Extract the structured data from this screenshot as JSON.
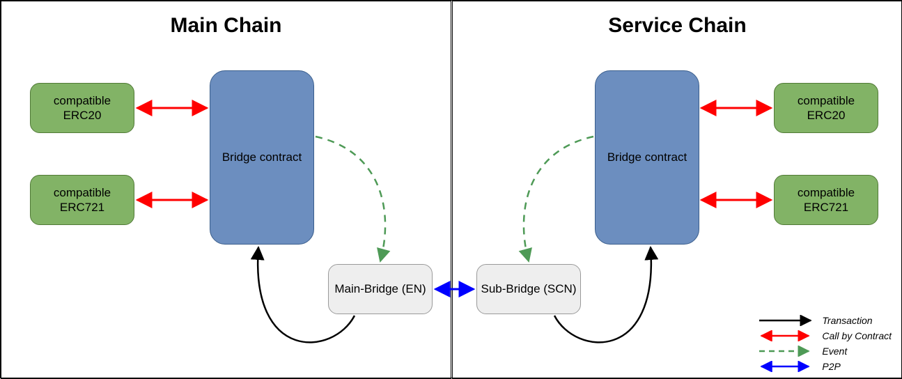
{
  "titles": {
    "main": "Main Chain",
    "service": "Service Chain"
  },
  "nodes": {
    "erc20_left": "compatible ERC20",
    "erc721_left": "compatible ERC721",
    "bridge_left": "Bridge contract",
    "main_bridge": "Main-Bridge (EN)",
    "sub_bridge": "Sub-Bridge (SCN)",
    "bridge_right": "Bridge contract",
    "erc20_right": "compatible ERC20",
    "erc721_right": "compatible ERC721"
  },
  "legend": {
    "transaction": "Transaction",
    "call_by_contract": "Call by Contract",
    "event": "Event",
    "p2p": "P2P"
  },
  "colors": {
    "green_fill": "#82b366",
    "green_stroke": "#507a36",
    "blue_fill": "#6c8ebf",
    "blue_stroke": "#3a5e8c",
    "grey_fill": "#eeeeee",
    "grey_stroke": "#999999",
    "arrow_red": "#ff0000",
    "arrow_green": "#4e9a56",
    "arrow_blue": "#0000ff",
    "arrow_black": "#000000"
  },
  "diagram_semantics": {
    "description": "Two-chain bridge architecture. Bridge contracts on each chain call ERC20/ERC721 compatible token contracts. Bridge contracts emit events to their local bridge nodes (Main-Bridge EN / Sub-Bridge SCN), which send transactions back to the opposite bridge contract. Main-Bridge and Sub-Bridge communicate over P2P.",
    "edges": [
      {
        "from": "bridge_left",
        "to": "erc20_left",
        "type": "call_by_contract",
        "bidirectional": true
      },
      {
        "from": "bridge_left",
        "to": "erc721_left",
        "type": "call_by_contract",
        "bidirectional": true
      },
      {
        "from": "bridge_right",
        "to": "erc20_right",
        "type": "call_by_contract",
        "bidirectional": true
      },
      {
        "from": "bridge_right",
        "to": "erc721_right",
        "type": "call_by_contract",
        "bidirectional": true
      },
      {
        "from": "bridge_left",
        "to": "main_bridge",
        "type": "event",
        "bidirectional": false
      },
      {
        "from": "bridge_right",
        "to": "sub_bridge",
        "type": "event",
        "bidirectional": false
      },
      {
        "from": "main_bridge",
        "to": "bridge_left",
        "type": "transaction",
        "bidirectional": false
      },
      {
        "from": "sub_bridge",
        "to": "bridge_right",
        "type": "transaction",
        "bidirectional": false
      },
      {
        "from": "main_bridge",
        "to": "sub_bridge",
        "type": "p2p",
        "bidirectional": true
      }
    ]
  }
}
